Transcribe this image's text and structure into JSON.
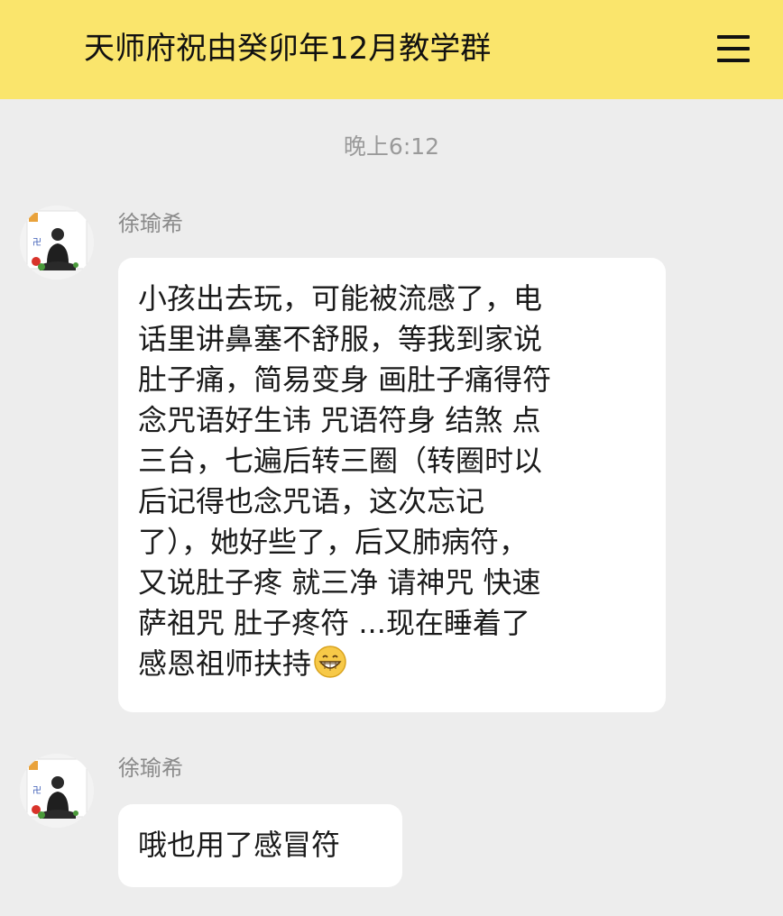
{
  "header": {
    "title": "天师府祝由癸卯年12月教学群",
    "menu_icon": "hamburger-menu-icon"
  },
  "chat": {
    "timestamp": "晚上6:12",
    "messages": [
      {
        "sender": "徐瑜希",
        "avatar_icon": "user-avatar",
        "text": "小孩出去玩，可能被流感了，电\n话里讲鼻塞不舒服，等我到家说\n肚子痛，简易变身 画肚子痛得符\n念咒语好生讳 咒语符身 结煞 点\n三台，七遍后转三圈（转圈时以\n后记得也念咒语，这次忘记\n了），她好些了，后又肺病符，\n又说肚子疼 就三净 请神咒 快速\n萨祖咒 肚子疼符 ...现在睡着了\n感恩祖师扶持",
        "trailing_emoji": "grinning-face-emoji"
      },
      {
        "sender": "徐瑜希",
        "avatar_icon": "user-avatar",
        "text": "哦也用了感冒符"
      }
    ]
  },
  "colors": {
    "header_bg": "#fae56c",
    "chat_bg": "#ededed",
    "bubble_bg": "#ffffff",
    "timestamp_text": "#9a9a9a",
    "sender_text": "#8a8a8a"
  }
}
